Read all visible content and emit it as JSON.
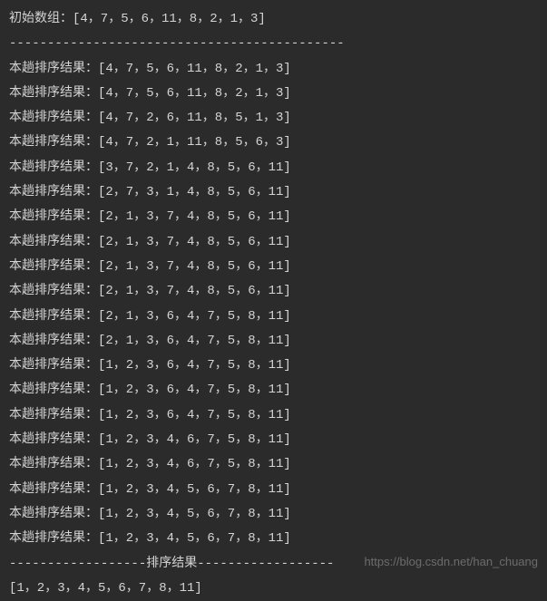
{
  "initial_label": "初始数组：",
  "initial_array": "[4，7，5，6，11，8，2，1，3]",
  "separator1": "--------------------------------------------",
  "pass_label": "本趟排序结果：",
  "passes": [
    "[4，7，5，6，11，8，2，1，3]",
    "[4，7，5，6，11，8，2，1，3]",
    "[4，7，2，6，11，8，5，1，3]",
    "[4，7，2，1，11，8，5，6，3]",
    "[3，7，2，1，4，8，5，6，11]",
    "[2，7，3，1，4，8，5，6，11]",
    "[2，1，3，7，4，8，5，6，11]",
    "[2，1，3，7，4，8，5，6，11]",
    "[2，1，3，7，4，8，5，6，11]",
    "[2，1，3，7，4，8，5，6，11]",
    "[2，1，3，6，4，7，5，8，11]",
    "[2，1，3，6，4，7，5，8，11]",
    "[1，2，3，6，4，7，5，8，11]",
    "[1，2，3，6，4，7，5，8，11]",
    "[1，2，3，6，4，7，5，8，11]",
    "[1，2，3，4，6，7，5，8，11]",
    "[1，2，3，4，6，7，5，8，11]",
    "[1，2，3，4，5，6，7，8，11]",
    "[1，2，3，4，5，6，7，8，11]",
    "[1，2，3，4，5，6，7，8，11]"
  ],
  "separator2": "------------------排序结果------------------",
  "final_array": "[1，2，3，4，5，6，7，8，11]",
  "watermark": "https://blog.csdn.net/han_chuang"
}
